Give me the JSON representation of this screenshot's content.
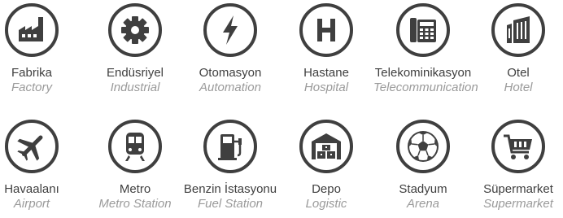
{
  "items": [
    {
      "label": "Fabrika",
      "sublabel": "Factory",
      "icon": "factory-icon"
    },
    {
      "label": "Endüsriyel",
      "sublabel": "Industrial",
      "icon": "gear-icon"
    },
    {
      "label": "Otomasyon",
      "sublabel": "Automation",
      "icon": "lightning-icon"
    },
    {
      "label": "Hastane",
      "sublabel": "Hospital",
      "icon": "hospital-h-icon"
    },
    {
      "label": "Telekominikasyon",
      "sublabel": "Telecommunication",
      "icon": "telephone-icon"
    },
    {
      "label": "Otel",
      "sublabel": "Hotel",
      "icon": "hotel-building-icon"
    },
    {
      "label": "Havaalanı",
      "sublabel": "Airport",
      "icon": "airplane-icon"
    },
    {
      "label": "Metro",
      "sublabel": "Metro Station",
      "icon": "train-icon"
    },
    {
      "label": "Benzin İstasyonu",
      "sublabel": "Fuel Station",
      "icon": "fuel-pump-icon"
    },
    {
      "label": "Depo",
      "sublabel": "Logistic",
      "icon": "warehouse-icon"
    },
    {
      "label": "Stadyum",
      "sublabel": "Arena",
      "icon": "soccer-ball-icon"
    },
    {
      "label": "Süpermarket",
      "sublabel": "Supermarket",
      "icon": "shopping-cart-icon"
    }
  ],
  "colors": {
    "icon": "#3f3f3f",
    "label": "#3f3f3f",
    "sublabel": "#9a9a9a"
  }
}
